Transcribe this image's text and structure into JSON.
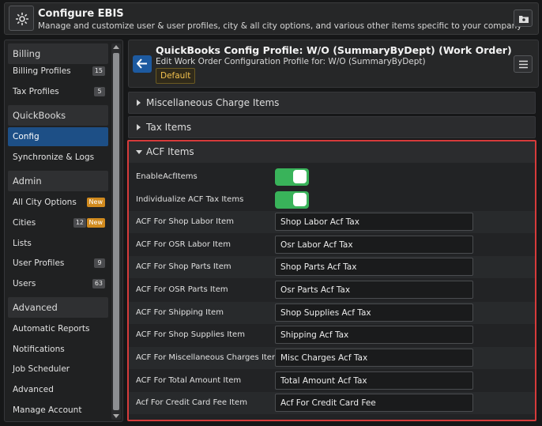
{
  "header": {
    "title": "Configure EBIS",
    "subtitle": "Manage and customize user & user profiles, city & all city options, and various other items specific to your company"
  },
  "sidebar": {
    "sections": [
      {
        "label": "Billing",
        "items": [
          {
            "label": "Billing Profiles",
            "badge": "15"
          },
          {
            "label": "Tax Profiles",
            "badge": "5"
          }
        ]
      },
      {
        "label": "QuickBooks",
        "items": [
          {
            "label": "Config",
            "active": true
          },
          {
            "label": "Synchronize & Logs"
          }
        ]
      },
      {
        "label": "Admin",
        "items": [
          {
            "label": "All City Options",
            "new": "New"
          },
          {
            "label": "Cities",
            "badge": "12",
            "new": "New"
          },
          {
            "label": "Lists"
          },
          {
            "label": "User Profiles",
            "badge": "9"
          },
          {
            "label": "Users",
            "badge": "63"
          }
        ]
      },
      {
        "label": "Advanced",
        "items": [
          {
            "label": "Automatic Reports"
          },
          {
            "label": "Notifications"
          },
          {
            "label": "Job Scheduler"
          },
          {
            "label": "Advanced"
          },
          {
            "label": "Manage Account"
          }
        ]
      }
    ]
  },
  "profile": {
    "title": "QuickBooks Config Profile: W/O (SummaryByDept) (Work Order)",
    "subtitle": "Edit Work Order Configuration Profile for: W/O (SummaryByDept)",
    "badge": "Default"
  },
  "accordions": {
    "misc": "Miscellaneous Charge Items",
    "tax": "Tax Items",
    "acf": "ACF Items"
  },
  "acf": {
    "toggles": [
      {
        "label": "EnableAcfItems",
        "on": true
      },
      {
        "label": "Individualize ACF Tax Items",
        "on": true
      }
    ],
    "fields": [
      {
        "label": "ACF For Shop Labor Item",
        "value": "Shop Labor Acf Tax"
      },
      {
        "label": "ACF For OSR Labor Item",
        "value": "Osr Labor Acf Tax"
      },
      {
        "label": "ACF For Shop Parts Item",
        "value": "Shop Parts Acf Tax"
      },
      {
        "label": "ACF For OSR Parts Item",
        "value": "Osr Parts Acf Tax"
      },
      {
        "label": "ACF For Shipping Item",
        "value": "Shop Supplies Acf Tax"
      },
      {
        "label": "ACF For Shop Supplies Item",
        "value": "Shipping Acf Tax"
      },
      {
        "label": "ACF For Miscellaneous Charges Item",
        "value": "Misc Charges Acf Tax"
      },
      {
        "label": "ACF For Total Amount Item",
        "value": "Total Amount Acf Tax"
      },
      {
        "label": "Acf For Credit Card Fee Item",
        "value": "Acf For Credit Card Fee"
      }
    ]
  },
  "colors": {
    "accent": "#1d4f86",
    "toggle_on": "#39b35a",
    "highlight_border": "#d63b3b",
    "new_badge": "#d08a1e",
    "default_badge_text": "#f2c14e"
  }
}
